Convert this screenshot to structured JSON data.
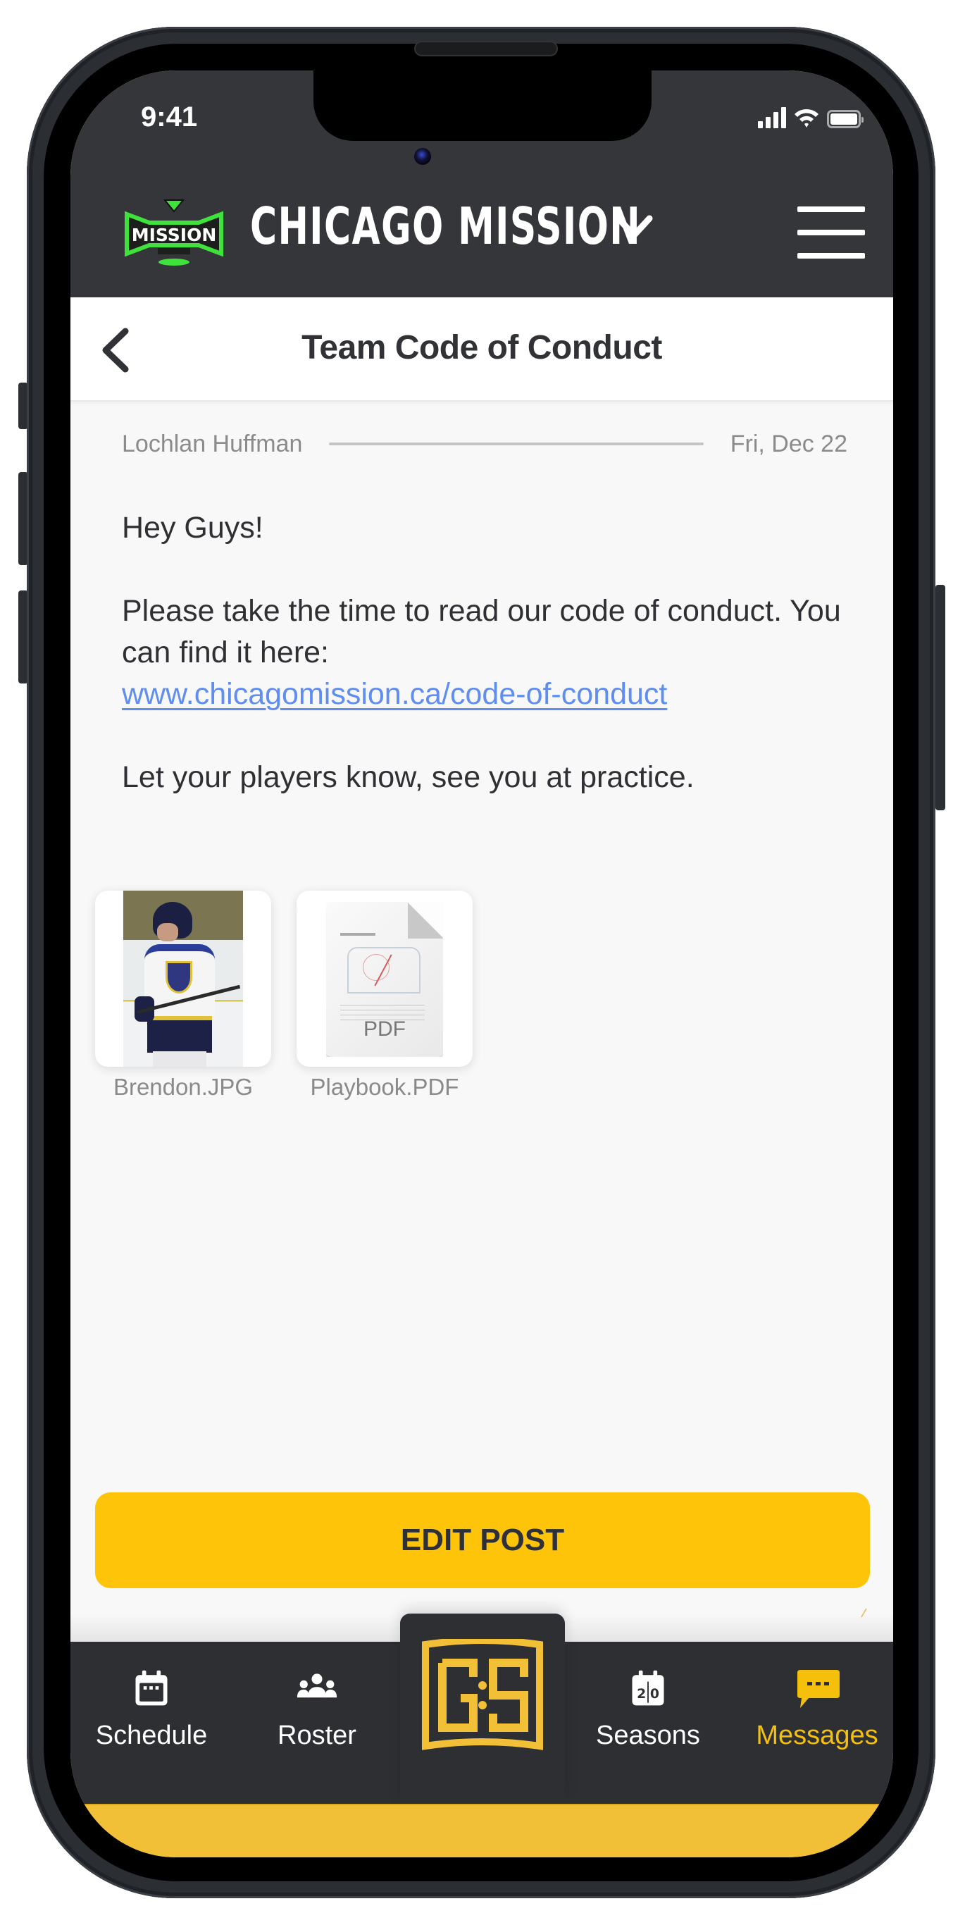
{
  "status_bar": {
    "time": "9:41",
    "icons": [
      "cellular-signal-icon",
      "wifi-icon",
      "battery-icon"
    ]
  },
  "header": {
    "brand_logo": "chicago-mission-logo",
    "brand_name": "CHICAGO MISSION",
    "dropdown_icon": "chevron-down-icon",
    "menu_icon": "hamburger-menu-icon"
  },
  "title_bar": {
    "back_icon": "chevron-left-icon",
    "title": "Team Code of Conduct"
  },
  "message": {
    "author": "Lochlan Huffman",
    "date": "Fri, Dec 22",
    "greeting": "Hey Guys!",
    "body_text": "Please take the time to read our code of conduct. You can find it here:",
    "link_text": "www.chicagomission.ca/code-of-conduct",
    "closing": "Let your players know, see you at practice."
  },
  "attachments": [
    {
      "name": "Brendon.JPG",
      "type": "image"
    },
    {
      "name": "Playbook.PDF",
      "type": "pdf",
      "badge": "PDF"
    }
  ],
  "actions": {
    "edit_post_label": "EDIT POST"
  },
  "bottom_nav": {
    "items": [
      {
        "label": "Schedule",
        "icon": "calendar-icon",
        "active": false
      },
      {
        "label": "Roster",
        "icon": "group-icon",
        "active": false
      },
      {
        "label": "",
        "icon": "gs-logo-icon",
        "active": false
      },
      {
        "label": "Seasons",
        "icon": "scoreboard-calendar-icon",
        "active": false
      },
      {
        "label": "Messages",
        "icon": "chat-bubble-icon",
        "active": true
      }
    ]
  },
  "colors": {
    "header_bg": "#35363a",
    "accent_yellow": "#fec40a",
    "active_nav": "#f5c00c",
    "link_blue": "#5f8ef0",
    "brand_green": "#3ee23a"
  }
}
